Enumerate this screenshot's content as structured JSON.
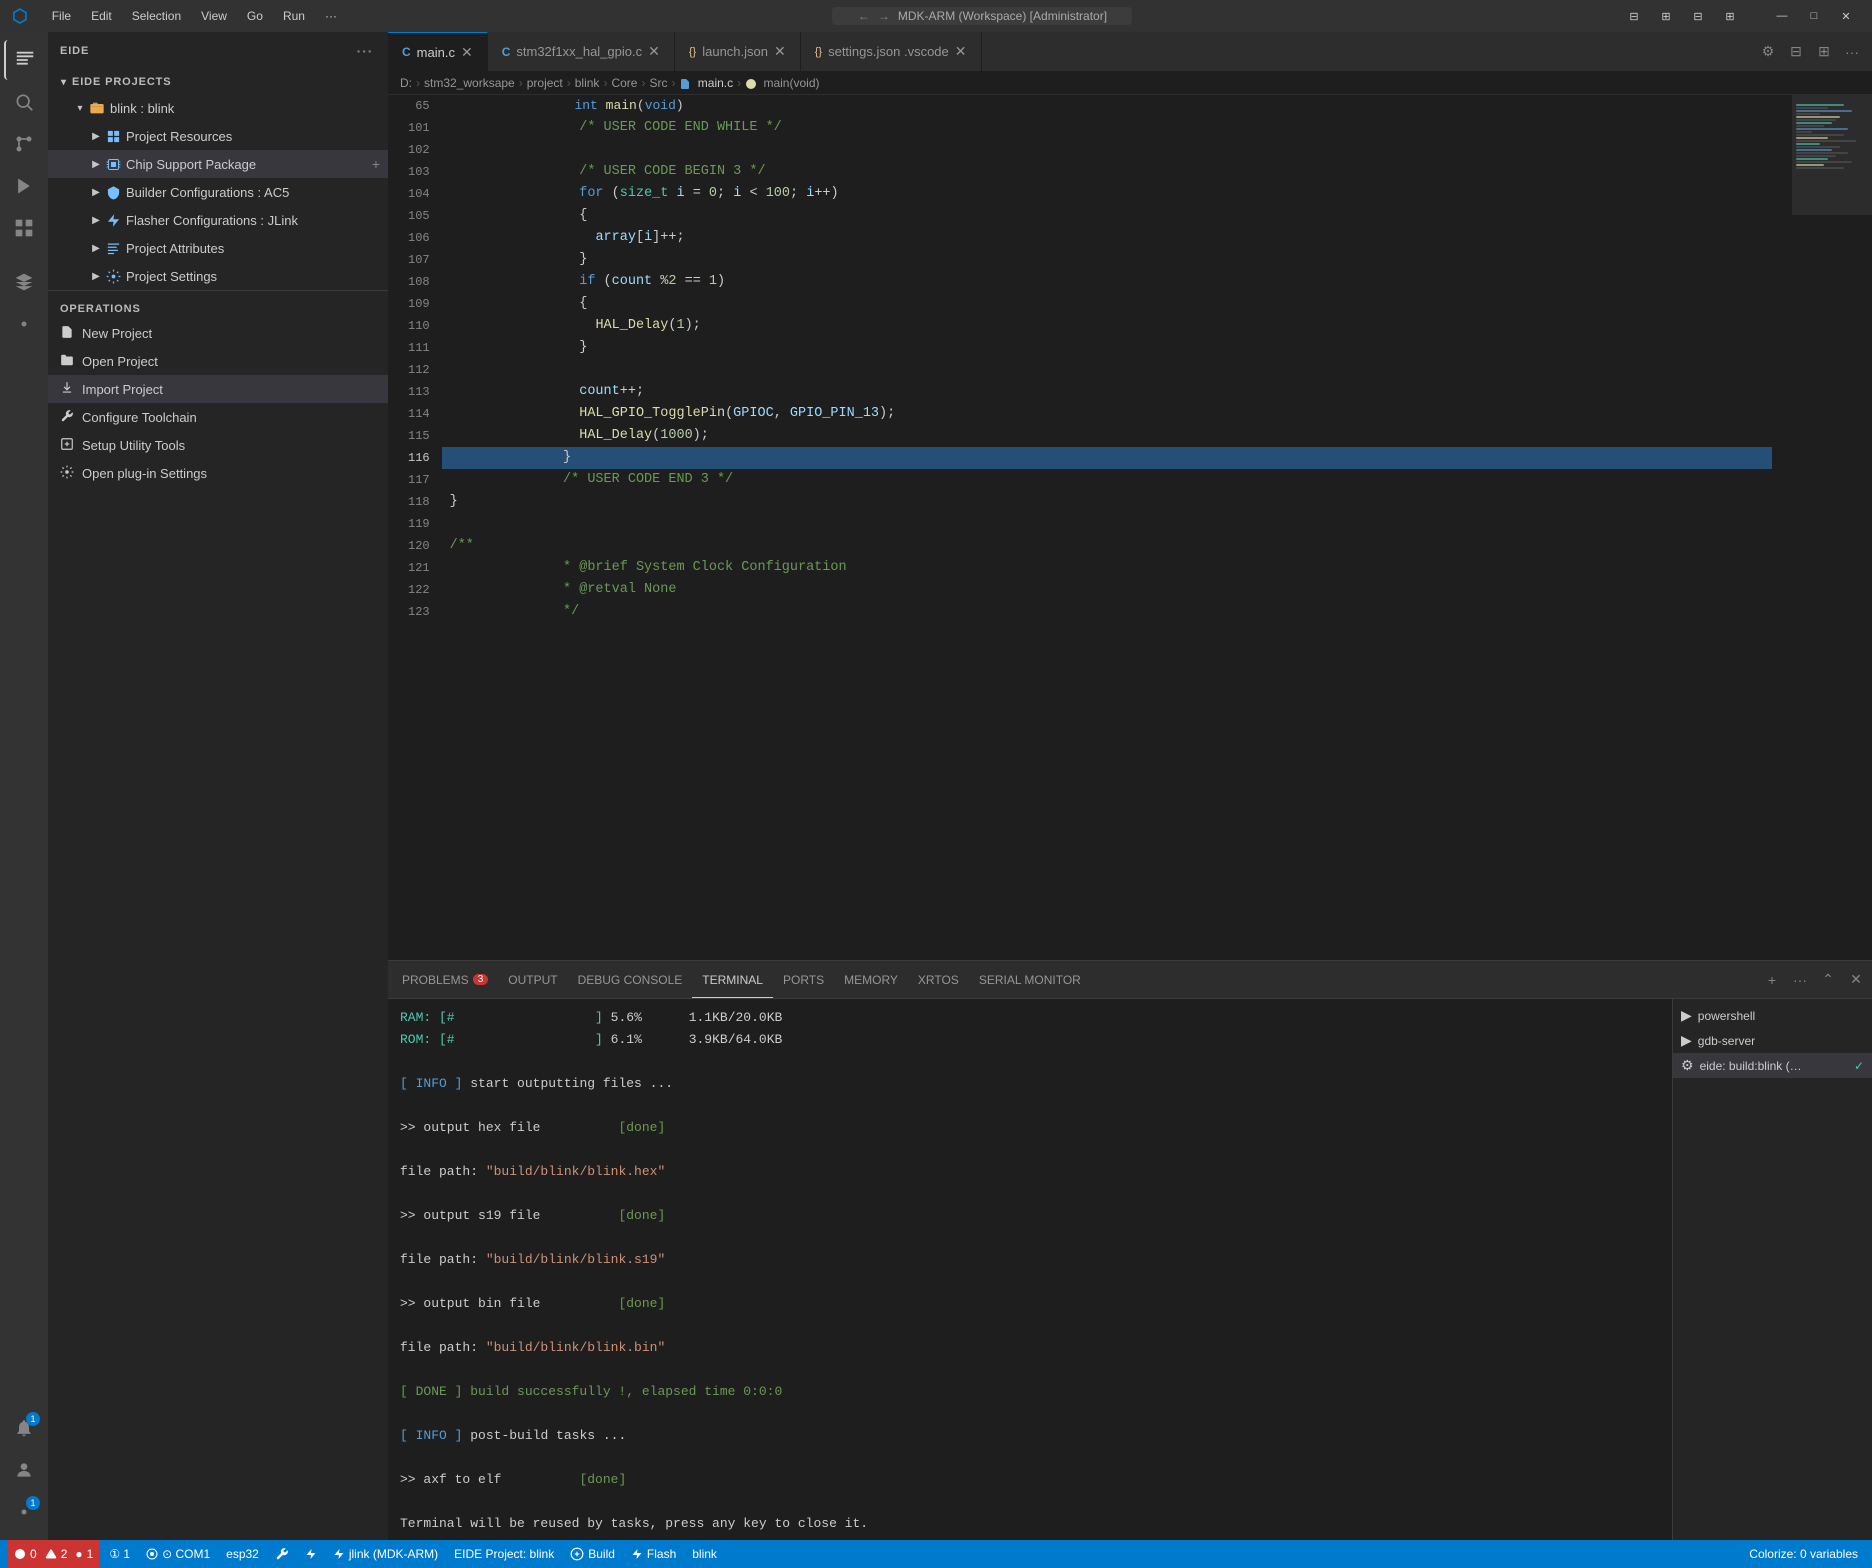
{
  "titleBar": {
    "logo": "⬡",
    "menu": [
      "File",
      "Edit",
      "Selection",
      "View",
      "Go",
      "Run",
      "···"
    ],
    "title": "MDK-ARM (Workspace) [Administrator]",
    "navBack": "←",
    "navFwd": "→",
    "winMin": "—",
    "winMax": "□",
    "winClose": "✕"
  },
  "activityBar": {
    "icons": [
      {
        "name": "explorer-icon",
        "symbol": "⎘",
        "active": true
      },
      {
        "name": "search-icon",
        "symbol": "🔍"
      },
      {
        "name": "source-control-icon",
        "symbol": "⎇"
      },
      {
        "name": "run-debug-icon",
        "symbol": "▶"
      },
      {
        "name": "extensions-icon",
        "symbol": "⊞"
      },
      {
        "name": "embedded-icon",
        "symbol": "⚡"
      },
      {
        "name": "settings-icon",
        "symbol": "⚙"
      },
      {
        "name": "notifications-icon",
        "symbol": "🔔",
        "badge": "1"
      }
    ],
    "bottomIcons": [
      {
        "name": "account-icon",
        "symbol": "👤"
      },
      {
        "name": "manage-icon",
        "symbol": "⚙",
        "badge": "1"
      }
    ]
  },
  "sidebar": {
    "title": "EIDE",
    "moreActions": "···",
    "projects": {
      "label": "EIDE PROJECTS",
      "items": [
        {
          "id": "blink-project",
          "label": "blink : blink",
          "icon": "📁",
          "expanded": true,
          "children": [
            {
              "id": "project-resources",
              "label": "Project Resources",
              "icon": "📦",
              "expanded": false
            },
            {
              "id": "chip-support-package",
              "label": "Chip Support Package",
              "icon": "🔧",
              "expanded": false,
              "selected": true,
              "addBtn": "+"
            },
            {
              "id": "builder-configurations",
              "label": "Builder Configurations : AC5",
              "icon": "🏗",
              "expanded": false
            },
            {
              "id": "flasher-configurations",
              "label": "Flasher Configurations : JLink",
              "icon": "⚡",
              "expanded": false
            },
            {
              "id": "project-attributes",
              "label": "Project Attributes",
              "icon": "📋",
              "expanded": false
            },
            {
              "id": "project-settings",
              "label": "Project Settings",
              "icon": "⚙",
              "expanded": false
            }
          ]
        }
      ]
    },
    "operations": {
      "label": "OPERATIONS",
      "items": [
        {
          "id": "new-project",
          "label": "New Project",
          "icon": "📄"
        },
        {
          "id": "open-project",
          "label": "Open Project",
          "icon": "📂"
        },
        {
          "id": "import-project",
          "label": "Import Project",
          "icon": "📥",
          "active": true
        },
        {
          "id": "configure-toolchain",
          "label": "Configure Toolchain",
          "icon": "🔧"
        },
        {
          "id": "setup-utility-tools",
          "label": "Setup Utility Tools",
          "icon": "🛠"
        },
        {
          "id": "open-plugin-settings",
          "label": "Open plug-in Settings",
          "icon": "⚙"
        }
      ]
    }
  },
  "tabs": [
    {
      "id": "main-c",
      "label": "main.c",
      "icon": "C",
      "iconColor": "#569cd6",
      "active": true,
      "closable": true
    },
    {
      "id": "stm32-hal-gpio",
      "label": "stm32f1xx_hal_gpio.c",
      "icon": "C",
      "iconColor": "#569cd6",
      "active": false,
      "closable": true
    },
    {
      "id": "launch-json",
      "label": "launch.json",
      "icon": "{}",
      "iconColor": "#e2c08d",
      "active": false,
      "closable": true
    },
    {
      "id": "settings-json-vscode",
      "label": "settings.json .vscode",
      "icon": "{}",
      "iconColor": "#e2c08d",
      "active": false,
      "closable": true
    }
  ],
  "tabsActions": {
    "settings": "⚙",
    "split": "⊟",
    "layout": "⊞",
    "more": "···"
  },
  "breadcrumb": {
    "parts": [
      "D:",
      "stm32_worksape",
      "project",
      "blink",
      "Core",
      "Src",
      "main.c",
      "main(void)"
    ]
  },
  "editor": {
    "functionHeader": "int main(void)",
    "lineStart": 101,
    "lines": [
      {
        "n": 101,
        "code": "    /* USER CODE END WHILE */"
      },
      {
        "n": 102,
        "code": ""
      },
      {
        "n": 103,
        "code": "    /* USER CODE BEGIN 3 */"
      },
      {
        "n": 104,
        "code": "    for (size_t i = 0; i < 100; i++)"
      },
      {
        "n": 105,
        "code": "    {"
      },
      {
        "n": 106,
        "code": "      array[i]++;"
      },
      {
        "n": 107,
        "code": "    }"
      },
      {
        "n": 108,
        "code": "    if (count %2 == 1)"
      },
      {
        "n": 109,
        "code": "    {"
      },
      {
        "n": 110,
        "code": "      HAL_Delay(1);"
      },
      {
        "n": 111,
        "code": "    }"
      },
      {
        "n": 112,
        "code": ""
      },
      {
        "n": 113,
        "code": "    count++;"
      },
      {
        "n": 114,
        "code": "    HAL_GPIO_TogglePin(GPIOC, GPIO_PIN_13);"
      },
      {
        "n": 115,
        "code": "    HAL_Delay(1000);"
      },
      {
        "n": 116,
        "code": "  }",
        "highlighted": true
      },
      {
        "n": 117,
        "code": "  /* USER CODE END 3 */"
      },
      {
        "n": 118,
        "code": "}"
      },
      {
        "n": 119,
        "code": ""
      },
      {
        "n": 120,
        "code": "/**"
      },
      {
        "n": 121,
        "code": "  * @brief System Clock Configuration"
      },
      {
        "n": 122,
        "code": "  * @retval None"
      },
      {
        "n": 123,
        "code": "  */"
      }
    ]
  },
  "terminal": {
    "tabs": [
      {
        "id": "problems",
        "label": "PROBLEMS",
        "badge": "3"
      },
      {
        "id": "output",
        "label": "OUTPUT"
      },
      {
        "id": "debug-console",
        "label": "DEBUG CONSOLE"
      },
      {
        "id": "terminal",
        "label": "TERMINAL",
        "active": true
      },
      {
        "id": "ports",
        "label": "PORTS"
      },
      {
        "id": "memory",
        "label": "MEMORY"
      },
      {
        "id": "xrtos",
        "label": "XRTOS"
      },
      {
        "id": "serial-monitor",
        "label": "SERIAL MONITOR"
      }
    ],
    "output": [
      "RAM: [#                   ]  5.6%      1.1KB/20.0KB",
      "ROM: [#                   ]  6.1%      3.9KB/64.0KB",
      "",
      "[ INFO ] start outputting files ...",
      "",
      ">> output hex file          [done]",
      "",
      "file path: \"build/blink/blink.hex\"",
      "",
      ">> output s19 file          [done]",
      "",
      "file path: \"build/blink/blink.s19\"",
      "",
      ">> output bin file          [done]",
      "",
      "file path: \"build/blink/blink.bin\"",
      "",
      "[ DONE ] build successfully !, elapsed time 0:0:0",
      "",
      "[ INFO ] post-build tasks ...",
      "",
      ">> axf to elf          [done]",
      "",
      "Terminal will be reused by tasks, press any key to close it."
    ],
    "shells": [
      {
        "id": "powershell",
        "label": "powershell",
        "icon": "▶"
      },
      {
        "id": "gdb-server",
        "label": "gdb-server",
        "icon": "▶"
      },
      {
        "id": "eide-build",
        "label": "eide: build:blink (…",
        "icon": "⚙",
        "active": true,
        "checkmark": true
      }
    ]
  },
  "statusBar": {
    "errorBadge": "✕ 0",
    "warnBadge": "⚠ 2 ● 1",
    "infoItem": "① 1",
    "com": "⊙ COM1",
    "esp32": "esp32",
    "buildIcon": "🔨",
    "flashIcon": "⚡",
    "jlink": "⚡ jlink (MDK-ARM)",
    "eideProject": "EIDE Project: blink",
    "build": "⊕ Build",
    "flash": "⚡ Flash",
    "blinkLabel": "blink",
    "colorize": "Colorize: 0 variables"
  }
}
